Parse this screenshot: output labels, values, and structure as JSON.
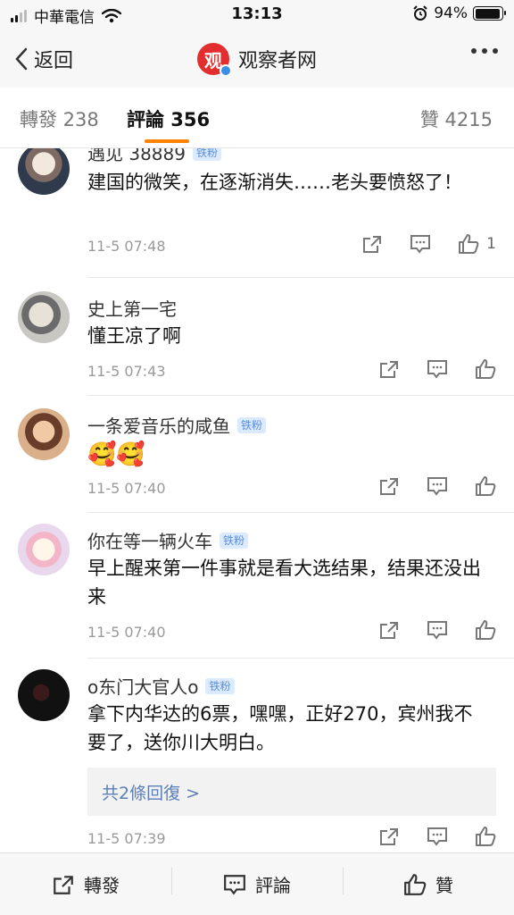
{
  "status_bar": {
    "carrier": "中華電信",
    "time": "13:13",
    "battery": "94%",
    "battery_level": 0.94,
    "icons": [
      "signal-icon",
      "wifi-icon",
      "alarm-icon",
      "battery-icon"
    ]
  },
  "nav": {
    "back_label": "返回",
    "title": "观察者网",
    "logo_text": "观",
    "more_icon": "more-dots-icon"
  },
  "tabs": {
    "repost": "轉發 238",
    "comment": "評論 356",
    "like": "贊 4215",
    "active_color": "#ff8200"
  },
  "comments": [
    {
      "username": "遇见 38889",
      "badge": "铁粉",
      "text": "建国的微笑，在逐渐消失……老头要愤怒了！",
      "time": "11-5 07:48",
      "likes": "1"
    },
    {
      "username": "史上第一宅",
      "badge": "",
      "text": "懂王凉了啊",
      "time": "11-5 07:43",
      "likes": ""
    },
    {
      "username": "一条爱音乐的咸鱼",
      "badge": "铁粉",
      "text": "🥰🥰",
      "time": "11-5 07:40",
      "likes": ""
    },
    {
      "username": "你在等一辆火车",
      "badge": "铁粉",
      "text": "早上醒来第一件事就是看大选结果，结果还没出来",
      "time": "11-5 07:40",
      "likes": ""
    },
    {
      "username": "o东门大官人o",
      "badge": "铁粉",
      "text": "拿下内华达的6票，嘿嘿，正好270，宾州我不要了，送你川大明白。",
      "time": "11-5 07:39",
      "likes": "",
      "replies": "共2條回復 >"
    }
  ],
  "bottom_bar": {
    "repost": "轉發",
    "comment": "評論",
    "like": "贊"
  }
}
